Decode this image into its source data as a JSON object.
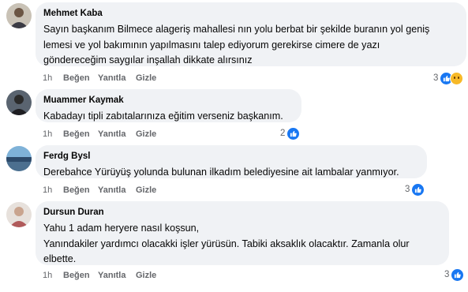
{
  "actions": {
    "time": "1h",
    "like": "Beğen",
    "reply": "Yanıtla",
    "hide": "Gizle"
  },
  "comments": [
    {
      "name": "Mehmet Kaba",
      "lines": [
        "Sayın başkanım Bilmece alageriş mahallesi nın yolu berbat bir şekilde buranın yol geniş",
        "lemesi ve yol bakımının yapılmasını talep ediyorum gerekirse cimere de yazı",
        "göndereceğim saygılar inşallah dikkate alırsınız"
      ],
      "reaction_count": "3",
      "reactions": [
        "like-icon",
        "sad-icon"
      ]
    },
    {
      "name": "Muammer Kaymak",
      "lines": [
        "Kabadayı tipli zabıtalarınıza eğitim verseniz başkanım."
      ],
      "reaction_count": "2",
      "reactions": [
        "like-icon"
      ]
    },
    {
      "name": "Ferdg Bysl",
      "lines": [
        "Derebahce Yürüyüş yolunda bulunan ilkadım belediyesine ait lambalar yanmıyor."
      ],
      "reaction_count": "3",
      "reactions": [
        "like-icon"
      ]
    },
    {
      "name": "Dursun Duran",
      "lines": [
        "Yahu 1 adam heryere nasıl koşsun,",
        "Yanındakiler yardımcı olacakki işler yürüsün. Tabiki aksaklık olacaktır. Zamanla olur",
        "elbette."
      ],
      "reaction_count": "3",
      "reactions": [
        "like-icon"
      ]
    }
  ],
  "colors": {
    "like": "#1877f2",
    "sad": "#f7b928",
    "bubble": "#f0f2f5",
    "meta": "#65676b"
  }
}
